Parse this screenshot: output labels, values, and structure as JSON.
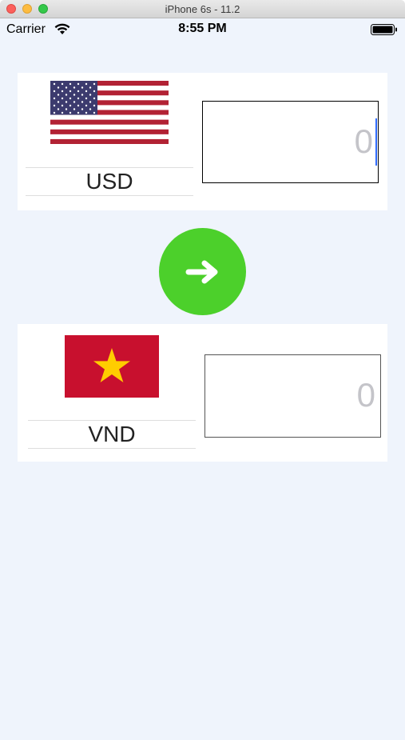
{
  "window": {
    "title": "iPhone 6s - 11.2"
  },
  "status_bar": {
    "carrier": "Carrier",
    "time": "8:55 PM"
  },
  "source": {
    "currency": "USD",
    "amount_placeholder": "0"
  },
  "target": {
    "currency": "VND",
    "amount_placeholder": "0"
  },
  "colors": {
    "background": "#eff4fc",
    "convert_button": "#4cd02b",
    "usd_red": "#b22234",
    "usd_blue": "#3c3b6e",
    "vnd_red": "#c8102e",
    "vnd_star": "#ffcd00"
  },
  "icons": {
    "convert": "arrow-right-icon",
    "wifi": "wifi-icon",
    "battery": "battery-icon"
  }
}
